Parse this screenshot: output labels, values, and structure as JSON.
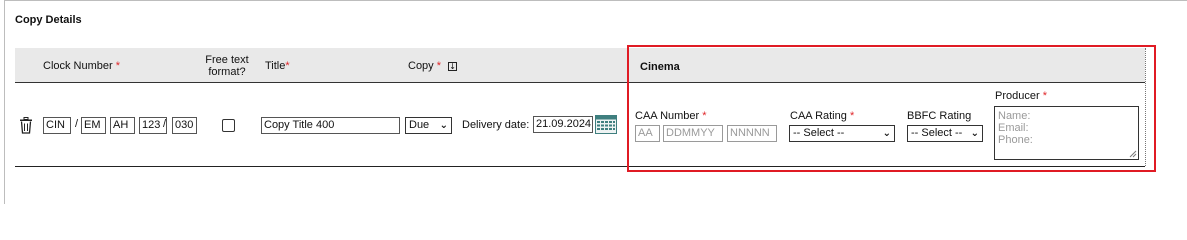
{
  "section": {
    "title": "Copy Details"
  },
  "headers": {
    "clock_number": "Clock Number",
    "free_text_line1": "Free text",
    "free_text_line2": "format?",
    "title": "Title",
    "copy": "Copy",
    "cinema": "Cinema",
    "required_marker": "*"
  },
  "row": {
    "clock_parts": [
      "CIN",
      "EM",
      "AH",
      "123",
      "030"
    ],
    "clock_separator": "/",
    "free_text_checked": false,
    "title_value": "Copy Title 400",
    "copy_select": "Due",
    "delivery_label": "Delivery date:",
    "delivery_date": "21.09.2024"
  },
  "cinema": {
    "caa_number_label": "CAA Number",
    "caa_placeholders": [
      "AA",
      "DDMMYY",
      "NNNNN"
    ],
    "caa_rating_label": "CAA Rating",
    "caa_rating_select": "-- Select --",
    "bbfc_rating_label": "BBFC Rating",
    "bbfc_rating_select": "-- Select --",
    "producer_label": "Producer",
    "producer_placeholder_lines": [
      "Name:",
      "Email:",
      "Phone:"
    ]
  },
  "colors": {
    "required": "#e0262a",
    "highlight": "#e01b24",
    "header_bg": "#e9e9e9"
  }
}
